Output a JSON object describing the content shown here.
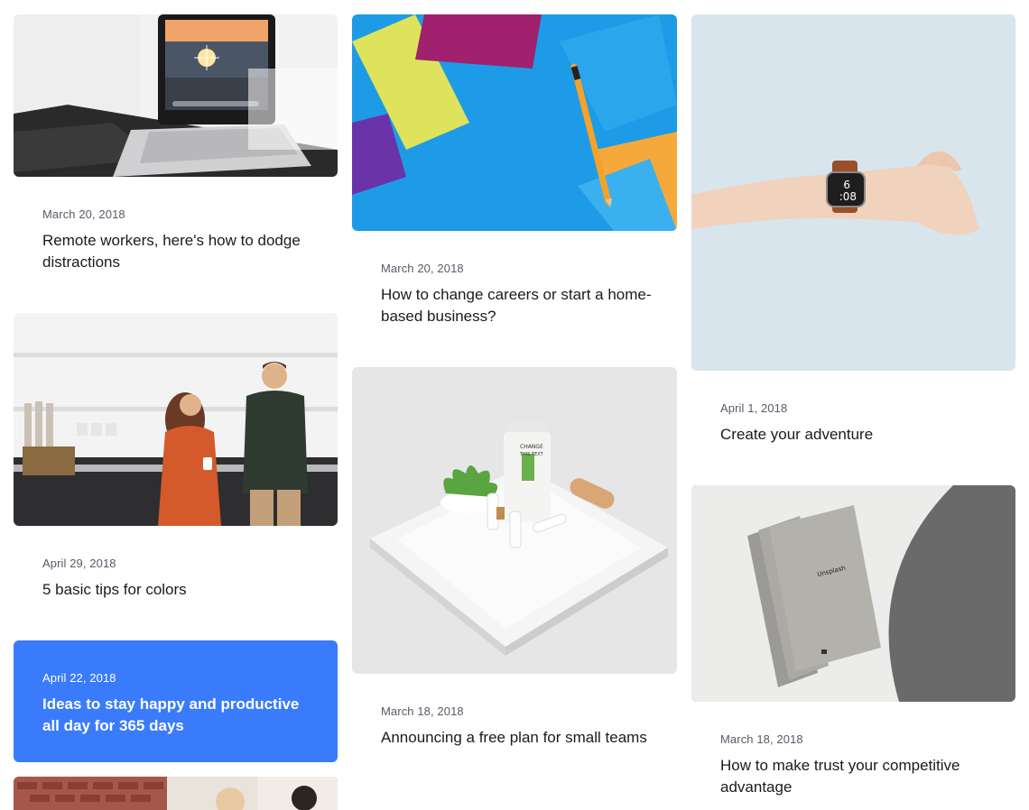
{
  "posts": [
    {
      "date": "March 20, 2018",
      "title": "Remote workers, here's how to dodge distractions"
    },
    {
      "date": "March 20, 2018",
      "title": "How to change careers or start a home-based business?"
    },
    {
      "date": "April 1, 2018",
      "title": "Create your adventure"
    },
    {
      "date": "April 29, 2018",
      "title": "5 basic tips for colors"
    },
    {
      "date": "March 18, 2018",
      "title": "Announcing a free plan for small teams"
    },
    {
      "date": "March 18, 2018",
      "title": "How to make trust your competitive advantage"
    },
    {
      "date": "April 22, 2018",
      "title": "Ideas to stay happy and productive all day for 365 days"
    }
  ],
  "images": {
    "watch_time": "6\n:08",
    "watch_time_line1": "6",
    "watch_time_line2": ":08",
    "notebook_brand": "Unsplash",
    "package_label_line1": "CHANGE",
    "package_label_line2": "THIS TEXT"
  },
  "colors": {
    "accent": "#3a7bfb",
    "text": "#1b1b1b",
    "muted": "#555c66"
  }
}
